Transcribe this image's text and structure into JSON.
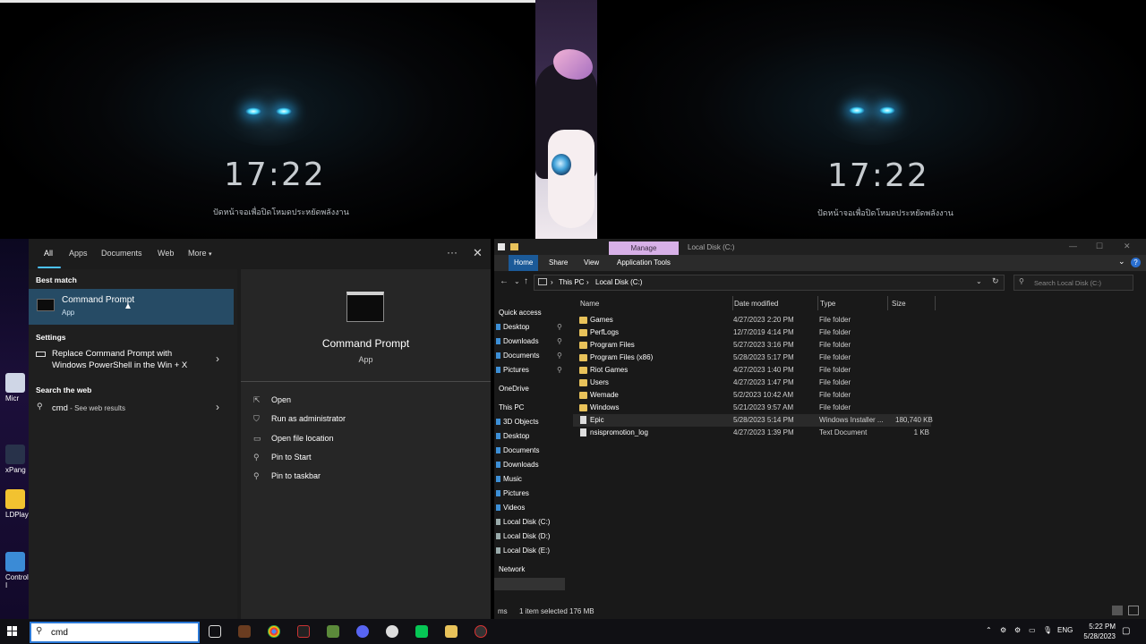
{
  "lockscreen": {
    "time": "17:22",
    "subtitle": "ปัดหน้าจอเพื่อปิดโหมดประหยัดพลังงาน"
  },
  "desktop_left": {
    "icons": [
      "Micr",
      "xPang",
      "LDPlay",
      "Control I"
    ]
  },
  "start_search": {
    "tabs": [
      "All",
      "Apps",
      "Documents",
      "Web",
      "More"
    ],
    "sections": {
      "best_match": "Best match",
      "settings": "Settings",
      "search_web": "Search the web"
    },
    "best_match": {
      "title": "Command Prompt",
      "subtitle": "App"
    },
    "settings_item": {
      "line1": "Replace Command Prompt with",
      "line2": "Windows PowerShell in the Win + X"
    },
    "web_item": {
      "query": "cmd",
      "suffix": " - See web results"
    },
    "preview": {
      "title": "Command Prompt",
      "subtitle": "App",
      "actions": [
        "Open",
        "Run as administrator",
        "Open file location",
        "Pin to Start",
        "Pin to taskbar"
      ]
    }
  },
  "explorer": {
    "manage_tab": "Manage",
    "title": "Local Disk (C:)",
    "ribbon_tabs": [
      "Home",
      "Share",
      "View",
      "Application Tools"
    ],
    "breadcrumb": [
      "This PC",
      "Local Disk (C:)"
    ],
    "search_placeholder": "Search Local Disk (C:)",
    "nav": [
      "Quick access",
      "Desktop",
      "Downloads",
      "Documents",
      "Pictures",
      "OneDrive",
      "This PC",
      "3D Objects",
      "Desktop",
      "Documents",
      "Downloads",
      "Music",
      "Pictures",
      "Videos",
      "Local Disk (C:)",
      "Local Disk (D:)",
      "Local Disk (E:)",
      "Network"
    ],
    "columns": [
      "Name",
      "Date modified",
      "Type",
      "Size"
    ],
    "rows": [
      {
        "name": "Games",
        "date": "4/27/2023 2:20 PM",
        "type": "File folder",
        "size": ""
      },
      {
        "name": "PerfLogs",
        "date": "12/7/2019 4:14 PM",
        "type": "File folder",
        "size": ""
      },
      {
        "name": "Program Files",
        "date": "5/27/2023 3:16 PM",
        "type": "File folder",
        "size": ""
      },
      {
        "name": "Program Files (x86)",
        "date": "5/28/2023 5:17 PM",
        "type": "File folder",
        "size": ""
      },
      {
        "name": "Riot Games",
        "date": "4/27/2023 1:40 PM",
        "type": "File folder",
        "size": ""
      },
      {
        "name": "Users",
        "date": "4/27/2023 1:47 PM",
        "type": "File folder",
        "size": ""
      },
      {
        "name": "Wemade",
        "date": "5/2/2023 10:42 AM",
        "type": "File folder",
        "size": ""
      },
      {
        "name": "Windows",
        "date": "5/21/2023 9:57 AM",
        "type": "File folder",
        "size": ""
      },
      {
        "name": "Epic",
        "date": "5/28/2023 5:14 PM",
        "type": "Windows Installer ...",
        "size": "180,740 KB"
      },
      {
        "name": "nsispromotion_log",
        "date": "4/27/2023 1:39 PM",
        "type": "Text Document",
        "size": "1 KB"
      }
    ],
    "status": {
      "items": "ms",
      "selected": "1 item selected  176 MB"
    }
  },
  "taskbar": {
    "search_value": "cmd",
    "lang": "ENG",
    "time": "5:22 PM",
    "date": "5/28/2023"
  }
}
